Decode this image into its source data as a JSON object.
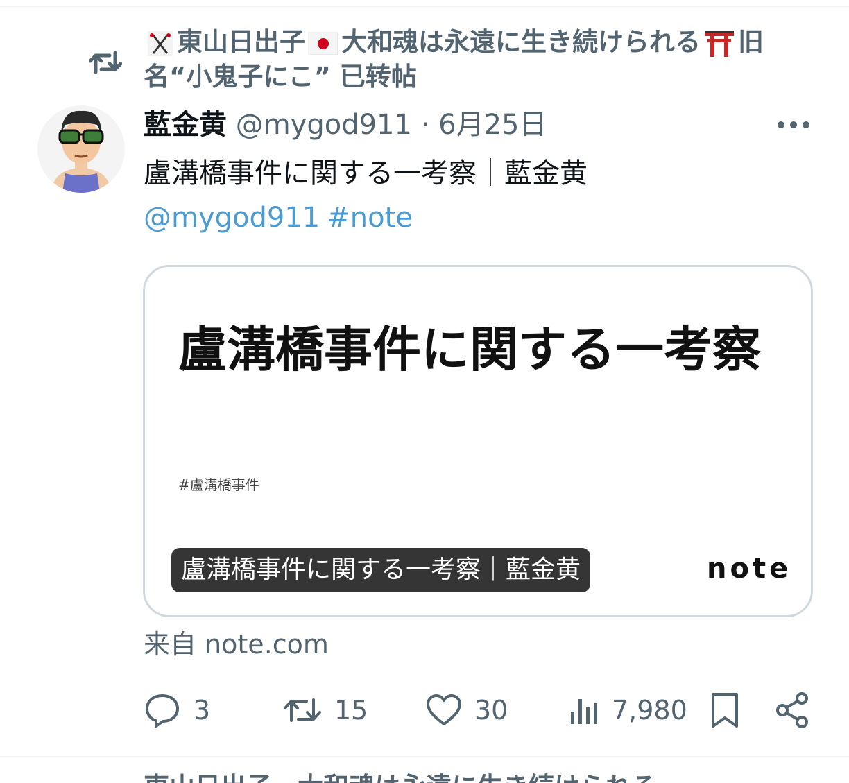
{
  "retweet": {
    "name_part1": "東山日出子",
    "name_part2": "大和魂は永遠に生き続けられる",
    "name_part3": "旧名“小鬼子にこ”",
    "action": "已转帖"
  },
  "tweet": {
    "author_name": "藍金黄",
    "author_handle": "@mygod911",
    "separator": "·",
    "date": "6月25日",
    "text": "盧溝橋事件に関する一考察｜藍金黄",
    "mention": "@mygod911",
    "hashtag": "#note"
  },
  "card": {
    "title": "盧溝橋事件に関する一考察",
    "tag": "#盧溝橋事件",
    "caption": "盧溝橋事件に関する一考察｜藍金黄",
    "logo_text": "note",
    "source": "来自 note.com"
  },
  "actions": {
    "replies": "3",
    "retweets": "15",
    "likes": "30",
    "views": "7,980"
  },
  "colors": {
    "secondary_text": "#536471",
    "link": "#4a9bd3",
    "border": "#cfd9de"
  },
  "icons": [
    "retweet-icon",
    "more-icon",
    "reply-icon",
    "like-icon",
    "views-icon",
    "bookmark-icon",
    "share-icon",
    "torii-emoji",
    "japan-flag-emoji"
  ]
}
